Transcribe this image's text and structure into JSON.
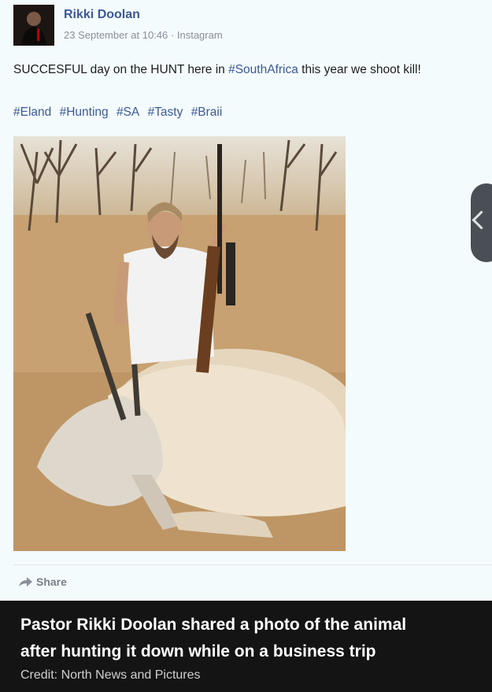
{
  "post": {
    "author": "Rikki Doolan",
    "timestamp": "23 September at 10:46",
    "separator": "·",
    "source": "Instagram",
    "text_before": "SUCCESFUL day on the HUNT here in ",
    "text_tag": "#SouthAfrica",
    "text_after": " this year we shoot kill!",
    "hashtags": [
      "#Eland",
      "#Hunting",
      "#SA",
      "#Tasty",
      "#Braii"
    ],
    "share_label": "Share",
    "share_icon": "share-arrow-icon"
  },
  "caption": {
    "line1": "Pastor Rikki Doolan shared a photo of the animal",
    "line2": "after hunting it down while on a business trip",
    "credit": "Credit: North News and Pictures"
  },
  "colors": {
    "link": "#3b5998",
    "caption_bg": "#141414",
    "post_bg": "#f4fbfd"
  }
}
